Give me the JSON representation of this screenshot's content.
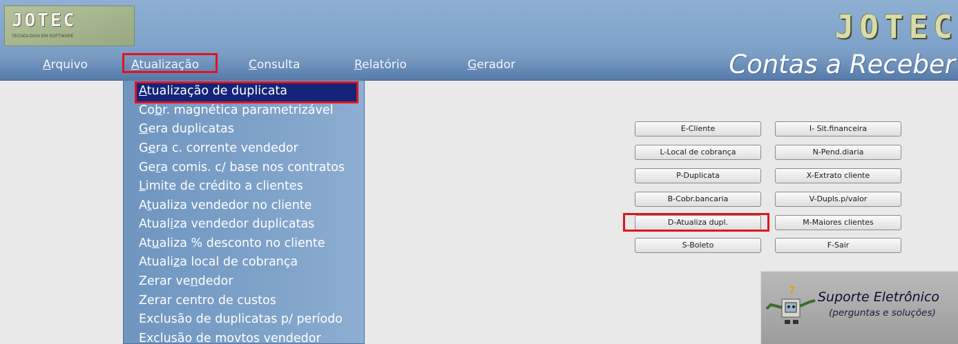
{
  "header": {
    "logo_text": "JOTEC",
    "logo_subtitle": "TECNOLOGIA EM SOFTWARE",
    "brand_text": "JOTEC",
    "app_title": "Contas a Receber"
  },
  "menubar": {
    "items": [
      {
        "pre": "",
        "u": "A",
        "post": "rquivo"
      },
      {
        "pre": "",
        "u": "A",
        "post": "tualização"
      },
      {
        "pre": "",
        "u": "C",
        "post": "onsulta"
      },
      {
        "pre": "",
        "u": "R",
        "post": "elatório"
      },
      {
        "pre": "",
        "u": "G",
        "post": "erador"
      }
    ]
  },
  "dropdown": {
    "items": [
      {
        "pre": "",
        "u": "A",
        "post": "tualização de duplicata"
      },
      {
        "pre": "Co",
        "u": "b",
        "post": "r. magnética parametrizável"
      },
      {
        "pre": "",
        "u": "G",
        "post": "era duplicatas"
      },
      {
        "pre": "G",
        "u": "e",
        "post": "ra c. corrente vendedor"
      },
      {
        "pre": "Ge",
        "u": "r",
        "post": "a comis. c/ base nos contratos"
      },
      {
        "pre": "",
        "u": "L",
        "post": "imite de crédito a clientes"
      },
      {
        "pre": "A",
        "u": "t",
        "post": "ualiza vendedor no cliente"
      },
      {
        "pre": "Atual",
        "u": "i",
        "post": "za vendedor duplicatas"
      },
      {
        "pre": "At",
        "u": "u",
        "post": "aliza % desconto no cliente"
      },
      {
        "pre": "Atuali",
        "u": "z",
        "post": "a local de cobrança"
      },
      {
        "pre": "Zerar ve",
        "u": "n",
        "post": "dedor"
      },
      {
        "pre": "Zerar centro de custos",
        "u": "",
        "post": ""
      },
      {
        "pre": "Exclusão de duplicatas p/ período",
        "u": "",
        "post": ""
      },
      {
        "pre": "Exclusão de movtos vendedor",
        "u": "",
        "post": ""
      }
    ]
  },
  "buttons": {
    "e_cliente": "E-Cliente",
    "i_sit_financeira": "I- Sit.financeira",
    "l_local_cobranca": "L-Local de cobrança",
    "n_pend_diaria": "N-Pend.diaria",
    "p_duplicata": "P-Duplicata",
    "x_extrato_cliente": "X-Extrato cliente",
    "b_cobr_bancaria": "B-Cobr.bancaria",
    "v_dupls_valor": "V-Dupls.p/valor",
    "d_atualiza_dupl": "D-Atualiza dupl.",
    "m_maiores_clientes": "M-Maiores clientes",
    "s_boleto": "S-Boleto",
    "f_sair": "F-Sair"
  },
  "support": {
    "title": "Suporte Eletrônico",
    "subtitle": "(perguntas e soluções)"
  },
  "colors": {
    "highlight_red": "#e0141e",
    "menu_blue": "#6b8fba",
    "selected_navy": "#14247a"
  }
}
